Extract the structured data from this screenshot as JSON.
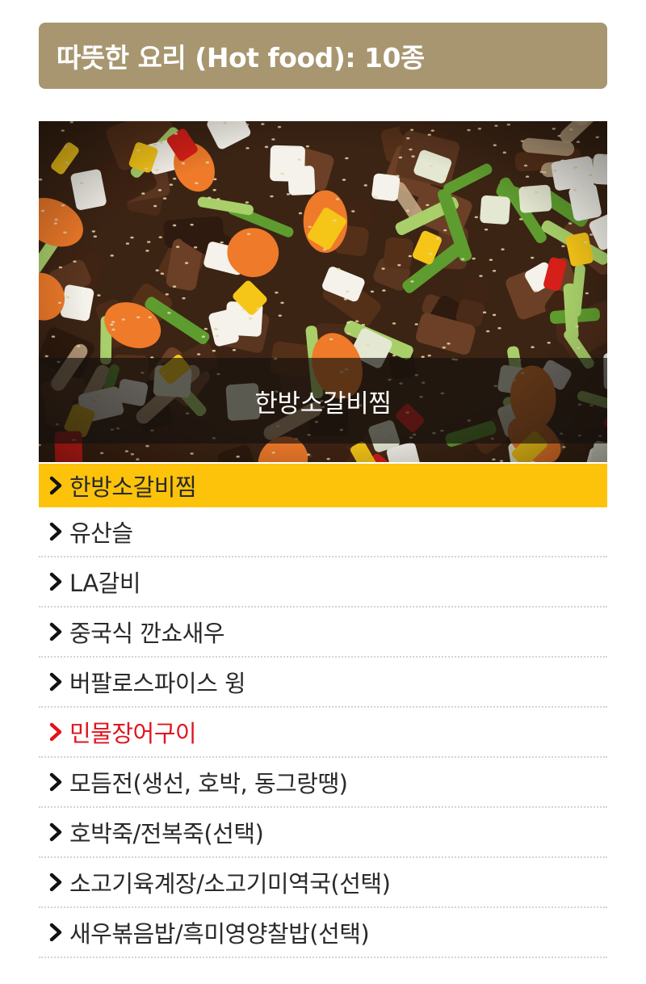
{
  "header": {
    "title": "따뜻한 요리 (Hot food): 10종"
  },
  "featured": {
    "caption": "한방소갈비찜",
    "image_icon": "braised-short-ribs-photo"
  },
  "menu": {
    "selected_color": "#fcc30a",
    "highlight_color": "#e0141e",
    "header_color": "#a79670",
    "items": [
      {
        "label": "한방소갈비찜",
        "state": "selected"
      },
      {
        "label": "유산슬",
        "state": "normal"
      },
      {
        "label": "LA갈비",
        "state": "normal"
      },
      {
        "label": "중국식 깐쇼새우",
        "state": "normal"
      },
      {
        "label": "버팔로스파이스 윙",
        "state": "normal"
      },
      {
        "label": "민물장어구이",
        "state": "highlight"
      },
      {
        "label": "모듬전(생선, 호박, 동그랑땡)",
        "state": "normal"
      },
      {
        "label": "호박죽/전복죽(선택)",
        "state": "normal"
      },
      {
        "label": "소고기육계장/소고기미역국(선택)",
        "state": "normal"
      },
      {
        "label": "새우볶음밥/흑미영양찰밥(선택)",
        "state": "normal"
      }
    ]
  }
}
